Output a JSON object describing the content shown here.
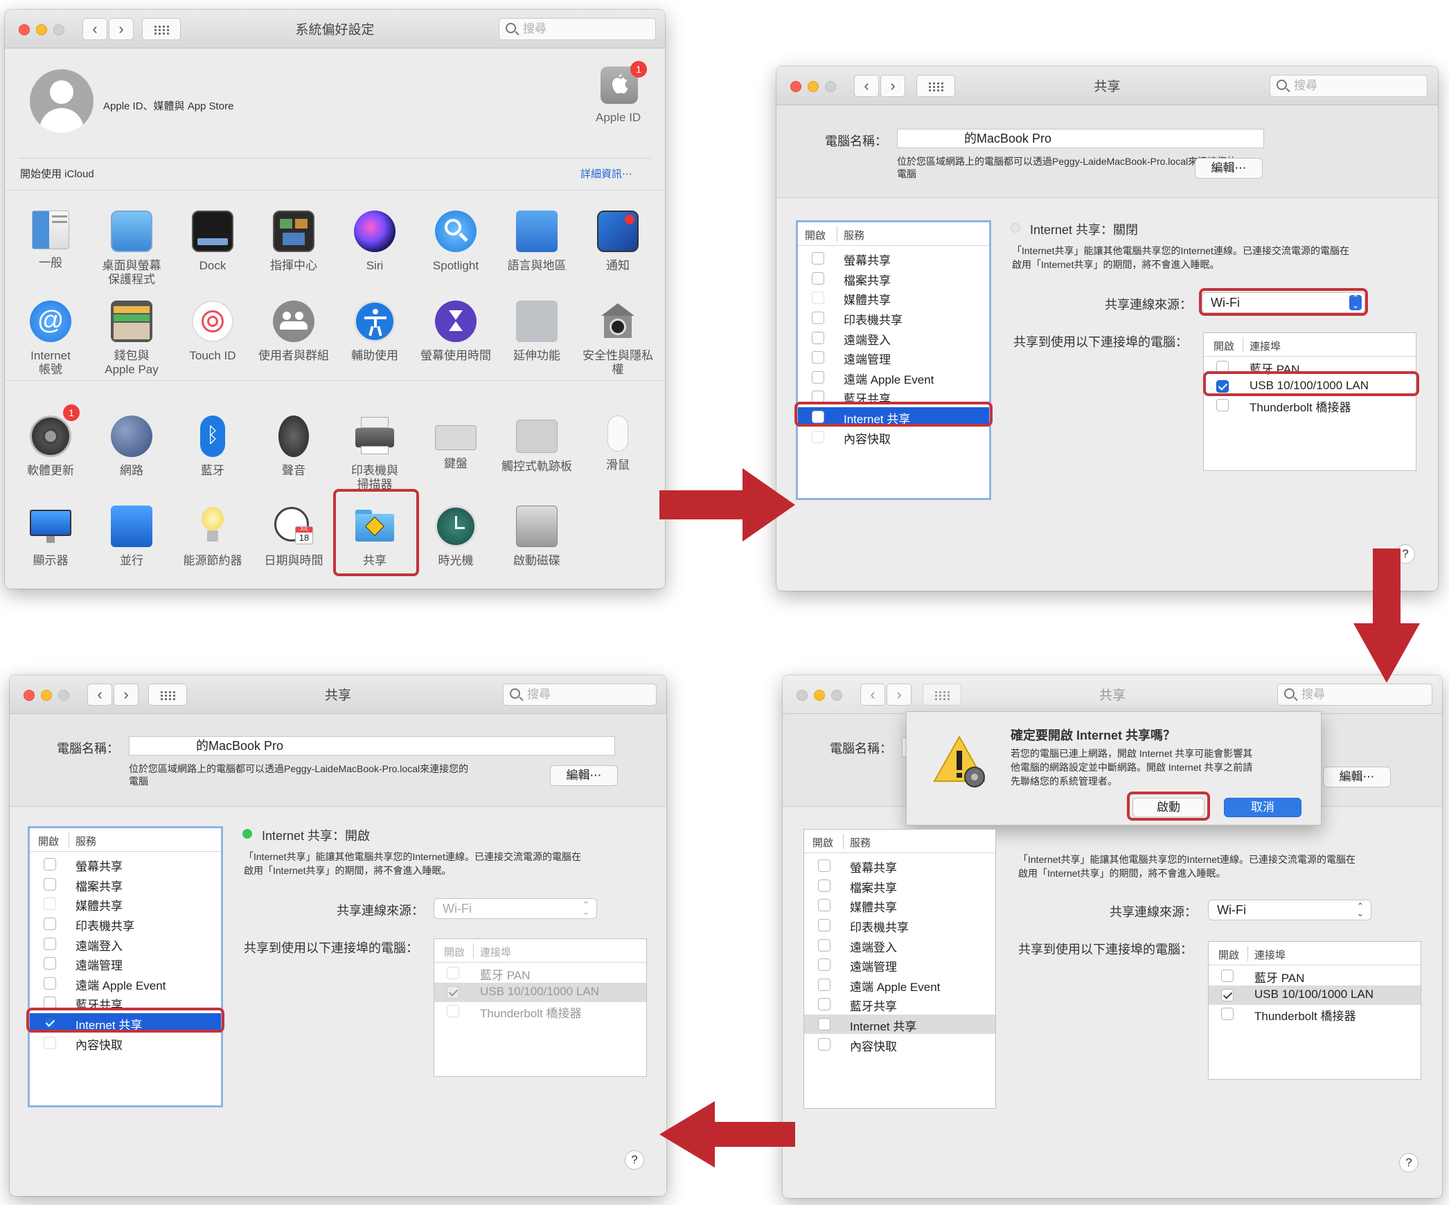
{
  "w1": {
    "title": "系統偏好設定",
    "search_placeholder": "搜尋",
    "apple_id_text": "Apple ID、媒體與 App Store",
    "apple_id_label": "Apple ID",
    "apple_id_badge": "1",
    "icloud_text": "開始使用 iCloud",
    "details_link": "詳細資訊⋯",
    "row1": [
      "一般",
      "桌面與螢幕\n保護程式",
      "Dock",
      "指揮中心",
      "Siri",
      "Spotlight",
      "語言與地區",
      "通知"
    ],
    "row2": [
      "Internet\n帳號",
      "錢包與\nApple Pay",
      "Touch ID",
      "使用者與群組",
      "輔助使用",
      "螢幕使用時間",
      "延伸功能",
      "安全性與隱私權"
    ],
    "row3": [
      "軟體更新",
      "網路",
      "藍牙",
      "聲音",
      "印表機與\n掃描器",
      "鍵盤",
      "觸控式軌跡板",
      "滑鼠"
    ],
    "row4": [
      "顯示器",
      "並行",
      "能源節約器",
      "日期與時間",
      "共享",
      "時光機",
      "啟動磁碟"
    ],
    "update_badge": "1",
    "calendar_month": "JUL",
    "calendar_day": "18"
  },
  "sharing": {
    "title": "共享",
    "search_placeholder": "搜尋",
    "computer_name_label": "電腦名稱：",
    "computer_name_value": "的MacBook Pro",
    "local_address_text": "位於您區域網路上的電腦都可以透過Peggy-LaideMacBook-Pro.local來連接您的\n電腦",
    "edit_button": "編輯⋯",
    "col_on": "開啟",
    "col_service": "服務",
    "services": [
      "螢幕共享",
      "檔案共享",
      "媒體共享",
      "印表機共享",
      "遠端登入",
      "遠端管理",
      "遠端 Apple Event",
      "藍牙共享",
      "Internet 共享",
      "內容快取"
    ],
    "internet_off_status": "Internet 共享：關閉",
    "internet_on_status": "Internet 共享：開啟",
    "description": "「Internet共享」能讓其他電腦共享您的Internet連線。已連接交流電源的電腦在\n啟用「Internet共享」的期間，將不會進入睡眠。",
    "source_label": "共享連線來源：",
    "source_value": "Wi-Fi",
    "ports_label": "共享到使用以下連接埠的電腦：",
    "col_port_on": "開啟",
    "col_port": "連接埠",
    "ports": [
      "藍牙 PAN",
      "USB 10/100/1000 LAN",
      "Thunderbolt 橋接器"
    ],
    "help": "?"
  },
  "dialog": {
    "title": "確定要開啟 Internet 共享嗎？",
    "message": "若您的電腦已連上網路，開啟 Internet 共享可能會影響其\n他電腦的網路設定並中斷網路。開啟 Internet 共享之前請\n先聯絡您的系統管理者。",
    "start_button": "啟動",
    "cancel_button": "取消"
  },
  "colors": {
    "highlight": "#c4333a",
    "selection": "#1d5fd9",
    "arrow": "#c0282f",
    "status_green": "#34c759"
  }
}
